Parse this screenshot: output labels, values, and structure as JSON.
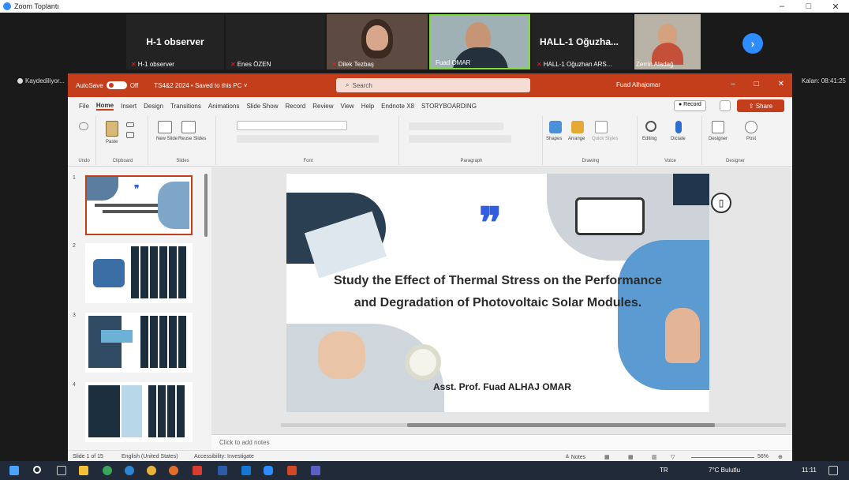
{
  "zoom": {
    "window_title": "Zoom Toplantı",
    "window_controls": [
      "–",
      "□",
      "✕"
    ],
    "participants": [
      {
        "big_name": "H-1 observer",
        "label": "H-1 observer",
        "has_video": false
      },
      {
        "big_name": "",
        "label": "Enes ÖZEN",
        "has_video": false
      },
      {
        "big_name": "",
        "label": "Dilek Tezbaş",
        "has_video": true
      },
      {
        "big_name": "",
        "label": "Fuad OMAR",
        "has_video": true
      },
      {
        "big_name": "HALL-1 Oğuzha...",
        "label": "HALL-1 Oğuzhan ARS...",
        "has_video": false
      },
      {
        "big_name": "",
        "label": "Zerrin Aladağ",
        "has_video": true
      }
    ],
    "recording_label": "Kaydediliyor...",
    "sharer_label": "Kalan: 08:41:25",
    "next_page_icon": "chevron-right-icon"
  },
  "ppt": {
    "autosave_label": "AutoSave",
    "autosave_state": "Off",
    "doc_name": "TS4&2 2024 • Saved to this PC ˅",
    "search_placeholder": "Search",
    "user_name": "Fuad Alhajomar",
    "menu": [
      "File",
      "Home",
      "Insert",
      "Design",
      "Transitions",
      "Animations",
      "Slide Show",
      "Record",
      "Review",
      "View",
      "Help",
      "Endnote X8",
      "STORYBOARDING"
    ],
    "record_label": "● Record",
    "share_label": "⇧ Share",
    "ribbon_groups": [
      {
        "label": "Undo",
        "items": []
      },
      {
        "label": "Clipboard",
        "items": [
          "Paste"
        ]
      },
      {
        "label": "Slides",
        "items": [
          "New Slide",
          "Reuse Slides"
        ]
      },
      {
        "label": "Font",
        "items": []
      },
      {
        "label": "Paragraph",
        "items": []
      },
      {
        "label": "Drawing",
        "items": [
          "Shapes",
          "Arrange",
          "Quick Styles"
        ]
      },
      {
        "label": "Voice",
        "items": [
          "Editing",
          "Dictate"
        ]
      },
      {
        "label": "Designer",
        "items": [
          "Designer",
          "Post"
        ]
      }
    ],
    "thumbnails": [
      "1",
      "2",
      "3",
      "4"
    ],
    "slide": {
      "title_line1": "Study the Effect of Thermal Stress on the Performance",
      "title_line2": "and Degradation of Photovoltaic Solar Modules.",
      "author": "Asst. Prof. Fuad  ALHAJ OMAR",
      "quote": "❞"
    },
    "notes_placeholder": "Click to add notes",
    "status": {
      "slide_count": "Slide 1 of 15",
      "language": "English (United States)",
      "accessibility": "Accessibility: Investigate",
      "notes": "≙ Notes",
      "zoom": "56%"
    }
  },
  "taskbar": {
    "lang": "TR",
    "weather": "7°C Bulutlu",
    "time": "11:11",
    "icons": [
      "windows-start-icon",
      "search-icon",
      "task-view-icon",
      "file-explorer-icon",
      "chrome-icon",
      "edge-icon",
      "chrome-icon",
      "firefox-icon",
      "acrobat-icon",
      "word-icon",
      "outlook-icon",
      "zoom-icon",
      "powerpoint-icon",
      "teams-icon"
    ]
  },
  "colors": {
    "ppt_accent": "#c43e1c",
    "zoom_blue": "#2d8cff",
    "quote_blue": "#2f5fe0"
  }
}
